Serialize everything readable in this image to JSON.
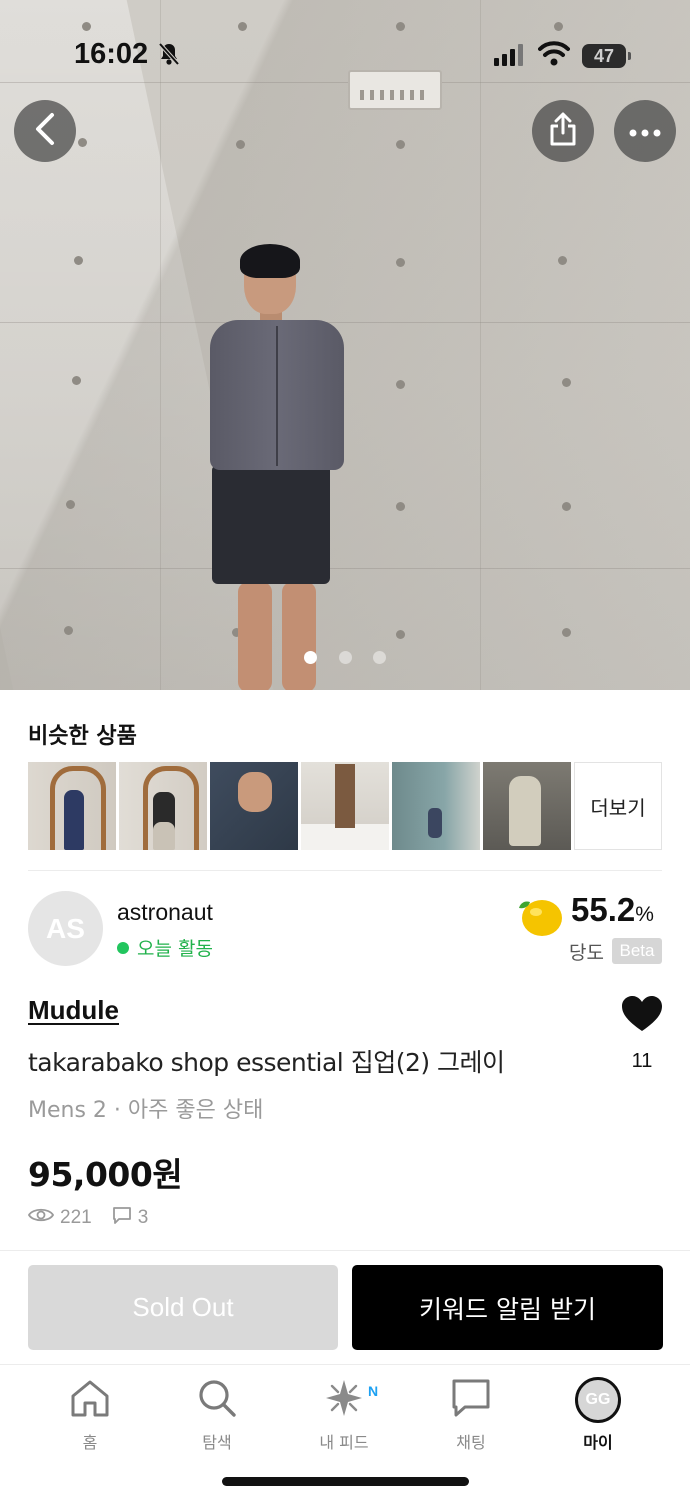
{
  "status_bar": {
    "time": "16:02",
    "battery": "47"
  },
  "hero": {
    "image_count": 3,
    "active_index": 0
  },
  "similar": {
    "title": "비슷한 상품",
    "more_label": "더보기"
  },
  "seller": {
    "initials": "AS",
    "name": "astronaut",
    "activity": "오늘 활동",
    "sugar_value": "55.2",
    "sugar_unit": "%",
    "sugar_label": "당도",
    "beta_label": "Beta"
  },
  "product": {
    "brand": "Mudule",
    "title": "takarabako shop essential 집업(2) 그레이",
    "condition": "Mens 2 · 아주 좋은 상태",
    "price": "95,000원",
    "views": "221",
    "comments": "3",
    "likes": "11"
  },
  "actions": {
    "sold_out_label": "Sold Out",
    "keyword_alert_label": "키워드 알림 받기"
  },
  "tabbar": {
    "items": [
      {
        "label": "홈",
        "icon": "home-icon"
      },
      {
        "label": "탐색",
        "icon": "search-icon"
      },
      {
        "label": "내 피드",
        "icon": "sparkle-icon"
      },
      {
        "label": "채팅",
        "icon": "chat-icon"
      },
      {
        "label": "마이",
        "icon": "profile-avatar"
      }
    ],
    "feed_badge": "N",
    "profile_initials": "GG",
    "active": "마이"
  },
  "colors": {
    "accent_green": "#22b24c",
    "primary_button": "#000000",
    "disabled_button": "#d9d9d9"
  }
}
